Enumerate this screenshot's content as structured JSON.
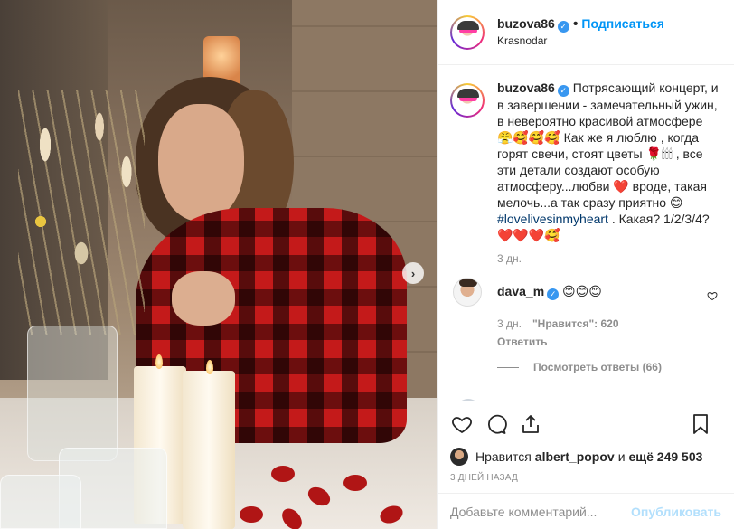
{
  "header": {
    "username": "buzova86",
    "separator": "•",
    "follow_label": "Подписаться",
    "location": "Krasnodar"
  },
  "caption": {
    "username": "buzova86",
    "text": "Потрясающий концерт, и в завершении - замечательный ужин, в невероятно красивой атмосфере 😤🥰🥰🥰 Как же я люблю , когда горят свечи, стоят цветы 🌹🕯🕯🕯 , все эти детали создают особую атмосферу...любви ❤️ вроде, такая мелочь...а так сразу приятно 😊",
    "hashtag": "#lovelivesinmyheart",
    "text_after": " . Какая? 1/2/3/4? ❤️❤️❤️🥰",
    "time": "3 дн."
  },
  "comment": {
    "username": "dava_m",
    "text": "😊😊😊",
    "time": "3 дн.",
    "likes": "\"Нравится\": 620",
    "reply_label": "Ответить",
    "view_replies": "Посмотреть ответы (66)"
  },
  "likes_line": {
    "prefix": "Нравится",
    "user": "albert_popov",
    "conj": "и",
    "more": "ещё 249 503"
  },
  "post_time": "3 ДНЕЙ НАЗАД",
  "add_comment": {
    "placeholder": "Добавьте комментарий...",
    "post_label": "Опубликовать"
  },
  "peek_hearts": "💙💙💙",
  "icons": {
    "verified": "✓",
    "next": "›"
  },
  "colors": {
    "accent": "#0095f6",
    "verified": "#3897f0",
    "muted": "#8e8e8e",
    "text": "#262626"
  }
}
